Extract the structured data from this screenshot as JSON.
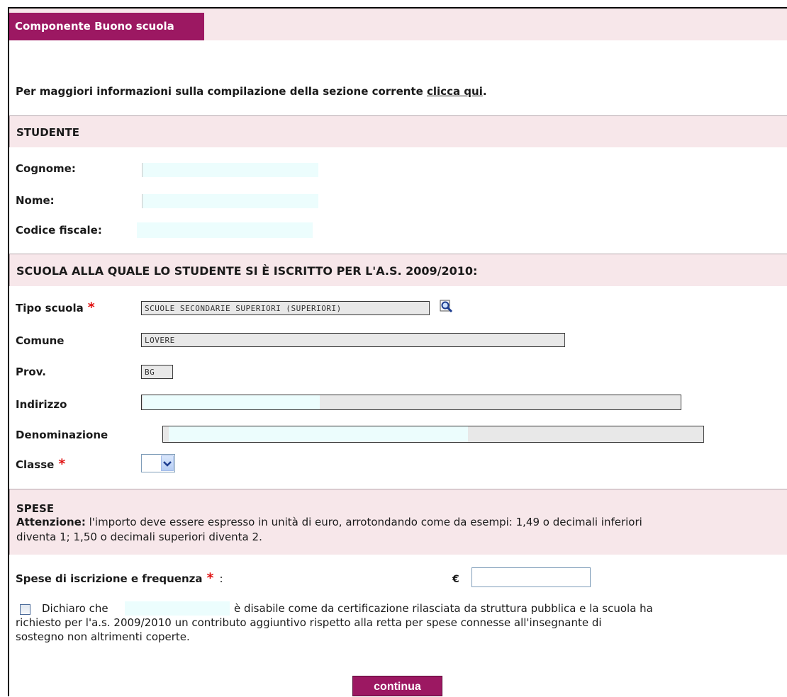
{
  "tab": {
    "label": "Componente Buono scuola"
  },
  "info": {
    "text": "Per maggiori informazioni sulla compilazione della sezione corrente ",
    "link": "clicca qui",
    "end": "."
  },
  "studente": {
    "title": "STUDENTE",
    "cognome_label": "Cognome",
    "nome_label": "Nome",
    "cf_label": "Codice fiscale",
    "colon": ":"
  },
  "scuola": {
    "title": "SCUOLA ALLA QUALE LO STUDENTE SI È ISCRITTO PER L'A.S. 2009/2010",
    "colon": ":",
    "tipo_label": "Tipo scuola",
    "tipo_value": "SCUOLE SECONDARIE SUPERIORI (SUPERIORI)",
    "comune_label": "Comune",
    "comune_value": "LOVERE",
    "prov_label": "Prov.",
    "prov_value": "BG",
    "indirizzo_label": "Indirizzo",
    "denominazione_label": "Denominazione",
    "classe_label": "Classe",
    "required_mark": "*"
  },
  "spese": {
    "title": "SPESE",
    "attention_bold": "Attenzione:",
    "attention_text": " l'importo deve essere espresso in unità di euro, arrotondando come da esempi: 1,49 o decimali inferiori",
    "attention_text2": "diventa 1; 1,50 o decimali superiori diventa 2.",
    "iscrizione_label": "Spese di iscrizione e frequenza",
    "colon": ":",
    "currency": "€"
  },
  "dichiaro": {
    "prefix": "Dichiaro che",
    "line1": "è disabile come da certificazione rilasciata da struttura pubblica e la scuola ha",
    "line2": "richiesto per l'a.s. 2009/2010 un contributo aggiuntivo rispetto alla retta per spese connesse all'insegnante di",
    "line3": "sostegno non altrimenti coperte."
  },
  "button": {
    "label": "continua"
  },
  "colors": {
    "accent": "#9c1862",
    "section_bg": "#f7e7ea",
    "required": "#e01010"
  }
}
